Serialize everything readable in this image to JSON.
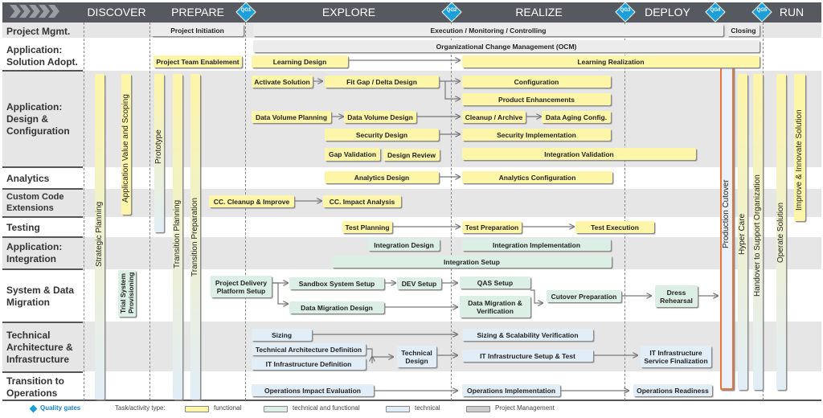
{
  "phases": [
    "DISCOVER",
    "PREPARE",
    "EXPLORE",
    "REALIZE",
    "DEPLOY",
    "RUN"
  ],
  "quality_gates": [
    "QG1",
    "QG2",
    "QG3",
    "QG4",
    "QG5"
  ],
  "lanes": [
    "Project Mgmt.",
    "Application: Solution Adopt.",
    "Application: Design & Configuration",
    "Analytics",
    "Custom Code Extensions",
    "Testing",
    "Application: Integration",
    "System & Data Migration",
    "Technical Architecture & Infrastructure",
    "Transition to Operations"
  ],
  "tasks": {
    "project_initiation": "Project Initiation",
    "execution": "Execution / Monitoring / Controlling",
    "closing": "Closing",
    "ocm": "Organizational Change Management (OCM)",
    "team_enablement": "Project Team Enablement",
    "learning_design": "Learning Design",
    "learning_realization": "Learning Realization",
    "activate_solution": "Activate Solution",
    "fit_gap": "Fit Gap / Delta Design",
    "configuration": "Configuration",
    "product_enh": "Product Enhancements",
    "dv_planning": "Data Volume Planning",
    "dv_design": "Data Volume Design",
    "cleanup": "Cleanup / Archive",
    "data_aging": "Data Aging Config.",
    "security_design": "Security Design",
    "security_impl": "Security Implementation",
    "gap_validation": "Gap Validation",
    "design_review": "Design Review",
    "integration_validation": "Integration Validation",
    "analytics_design": "Analytics Design",
    "analytics_config": "Analytics Configuration",
    "cc_cleanup": "CC. Cleanup & Improve",
    "cc_impact": "CC. Impact Analysis",
    "test_planning": "Test Planning",
    "test_prep": "Test Preparation",
    "test_exec": "Test Execution",
    "integration_design": "Integration Design",
    "integration_impl": "Integration Implementation",
    "integration_setup": "Integration Setup",
    "pdp_setup": "Project Delivery Platform Setup",
    "sandbox": "Sandbox System Setup",
    "dev_setup": "DEV Setup",
    "qas_setup": "QAS Setup",
    "dm_design": "Data Migration Design",
    "dm_verif": "Data Migration & Verification",
    "cutover_prep": "Cutover Preparation",
    "dress": "Dress Rehearsal",
    "sizing": "Sizing",
    "sizing_verif": "Sizing & Scalability Verification",
    "ta_def": "Technical Architecture Definition",
    "it_def": "IT Infrastructure Definition",
    "tech_design": "Technical Design",
    "it_setup": "IT Infrastructure Setup & Test",
    "it_final": "IT Infrastructure Service Finalization",
    "ops_eval": "Operations Impact Evaluation",
    "ops_impl": "Operations Implementation",
    "ops_ready": "Operations Readiness"
  },
  "vertical": {
    "strategic": "Strategic Planning",
    "app_value": "Application Value and Scoping",
    "trial": "Trial System Provisioning",
    "prototype": "Prototype",
    "trans_plan": "Transition Planning",
    "trans_prep": "Transition Preparation",
    "prod_cutover": "Production Cutover",
    "hyper": "Hyper Care",
    "handover": "Handover to Support Organization",
    "operate": "Operate Solution",
    "improve": "Improve & Innovate Solution"
  },
  "legend": {
    "qg": "Quality gates",
    "type": "Task/activity type:",
    "functional": "functional",
    "tf": "technical and functional",
    "technical": "technical",
    "pm": "Project Management"
  },
  "colors": {
    "functional": "#fdf5a8",
    "tech_func": "#dcefe5",
    "technical": "#e1edf7",
    "pm": "#ececec",
    "qg": "#1c9fd8",
    "cutover": "#e8763a"
  }
}
